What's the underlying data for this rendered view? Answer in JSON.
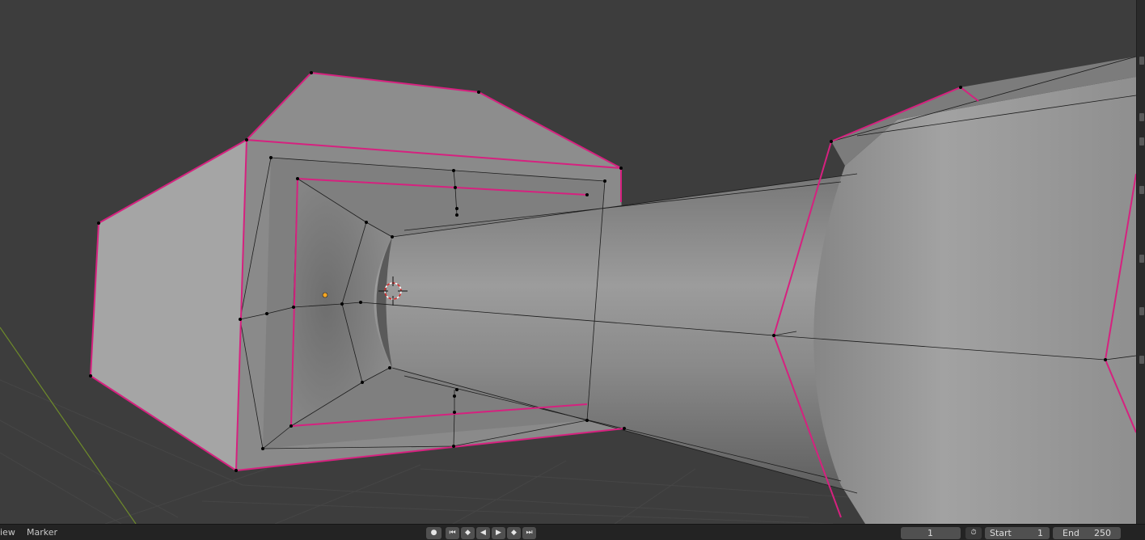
{
  "timeline": {
    "menus": [
      "iew",
      "Marker"
    ],
    "playback_buttons": [
      {
        "name": "record-button",
        "icon": "record-icon",
        "glyph": "●"
      },
      {
        "name": "jump-start-button",
        "icon": "jump-to-start-icon",
        "glyph": "⏮"
      },
      {
        "name": "prev-keyframe-button",
        "icon": "previous-keyframe-icon",
        "glyph": "◆"
      },
      {
        "name": "play-reverse-button",
        "icon": "play-reverse-icon",
        "glyph": "◀"
      },
      {
        "name": "play-button",
        "icon": "play-icon",
        "glyph": "▶"
      },
      {
        "name": "next-keyframe-button",
        "icon": "next-keyframe-icon",
        "glyph": "◆"
      },
      {
        "name": "jump-end-button",
        "icon": "jump-to-end-icon",
        "glyph": "⏭"
      }
    ],
    "current_frame": "1",
    "start_label": "Start",
    "start_value": "1",
    "end_label": "End",
    "end_value": "250"
  },
  "colors": {
    "viewport_bg": "#3d3d3d",
    "mesh_face": "#8e8e8e",
    "selected_edge": "#d6217f",
    "edge": "#1a1a1a",
    "vertex": "#000000",
    "origin": "#f5a623",
    "axis_y": "#6e8b2a",
    "header_bg": "#232323"
  }
}
